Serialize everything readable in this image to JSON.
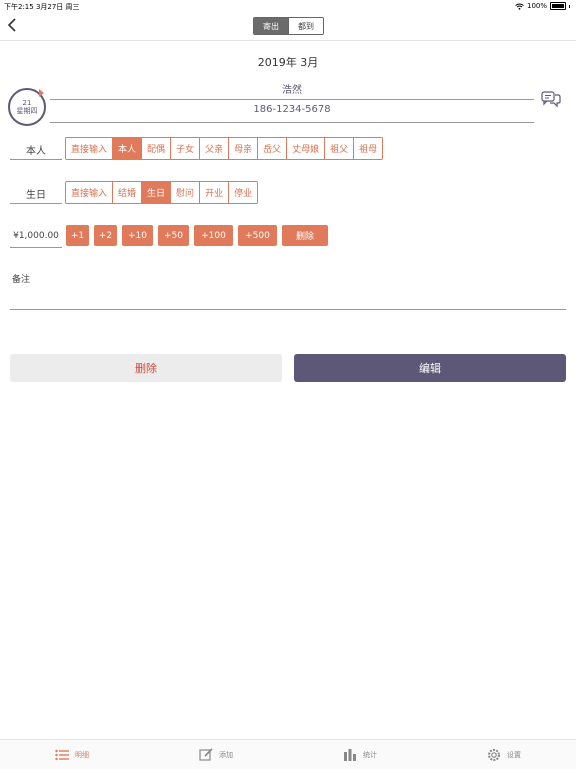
{
  "status_bar": {
    "time_date": "下午2:15   3月27日 周三",
    "battery": "100%"
  },
  "segment": {
    "send_label": "寄出",
    "receive_label": "都到"
  },
  "month_header": "2019年 3月",
  "calendar": {
    "day": "21",
    "weekday": "星期四"
  },
  "contact": {
    "name": "浩然",
    "phone": "186-1234-5678"
  },
  "relation": {
    "label": "本人",
    "options": [
      "直接输入",
      "本人",
      "配偶",
      "子女",
      "父亲",
      "母亲",
      "岳父",
      "丈母娘",
      "祖父",
      "祖母"
    ],
    "selected": "本人"
  },
  "event": {
    "label": "生日",
    "options": [
      "直接输入",
      "结婚",
      "生日",
      "慰问",
      "开业",
      "停业"
    ],
    "selected": "生日"
  },
  "amount": {
    "value": "¥1,000.00",
    "increments": [
      "+1",
      "+2",
      "+10",
      "+50",
      "+100",
      "+500"
    ],
    "clear_label": "删除"
  },
  "remark_label": "备注",
  "actions": {
    "delete_label": "删除",
    "edit_label": "编辑"
  },
  "tabs": [
    {
      "label": "明细",
      "icon": "list-icon"
    },
    {
      "label": "添加",
      "icon": "edit-icon"
    },
    {
      "label": "统计",
      "icon": "bar-chart-icon"
    },
    {
      "label": "设置",
      "icon": "gear-icon"
    }
  ],
  "colors": {
    "accent": "#e07a5a",
    "primary": "#5e5878",
    "danger": "#d44a3a"
  }
}
